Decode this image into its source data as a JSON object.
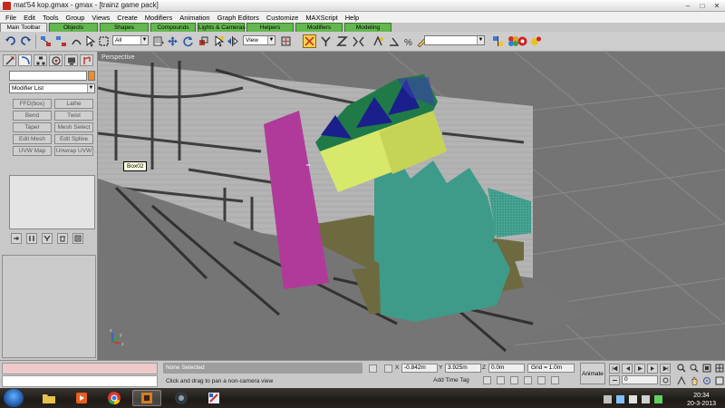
{
  "window": {
    "title": "mat'54 kop.gmax - gmax - [trainz game pack]"
  },
  "menu": [
    "File",
    "Edit",
    "Tools",
    "Group",
    "Views",
    "Create",
    "Modifiers",
    "Animation",
    "Graph Editors",
    "Customize",
    "MAXScript",
    "Help"
  ],
  "tabs": [
    "Main Toolbar",
    "Objects",
    "Shapes",
    "Compounds",
    "Lights & Cameras",
    "Helpers",
    "Modifiers",
    "Modeling"
  ],
  "toolbar": {
    "selection_filter": "All",
    "ref_coord": "View",
    "named_selection": ""
  },
  "command_panel": {
    "object_name": "",
    "modifier_list": "Modifier List",
    "modifier_buttons": [
      "FFD(box)",
      "Lathe",
      "Bend",
      "Twist",
      "Taper",
      "Mesh Select",
      "Edit Mesh",
      "Edit Spline",
      "UVW Map",
      "Unwrap UVW"
    ]
  },
  "viewport": {
    "label": "Perspective",
    "tooltip": "Box02"
  },
  "status": {
    "selection": "None Selected",
    "prompt": "Click and drag to pan a non-camera view",
    "x_label": "X",
    "x_value": "-0.842m",
    "y_label": "Y",
    "y_value": "3.925m",
    "z_label": "Z",
    "z_value": "0.0m",
    "grid": "Grid = 1.0m",
    "add_time_tag": "Add Time Tag",
    "animate": "Animate",
    "frame": "0"
  },
  "taskbar": {
    "time": "20:34",
    "date": "20-3-2013"
  },
  "colors": {
    "tab_green": "#64b650",
    "magenta_poly": "#b03a9a",
    "yellow_poly": "#d8e86a",
    "teal_poly": "#3e9b8a",
    "navy_poly": "#1a1f8c",
    "green_poly": "#1f7a48",
    "olive_poly": "#6e6a40"
  }
}
